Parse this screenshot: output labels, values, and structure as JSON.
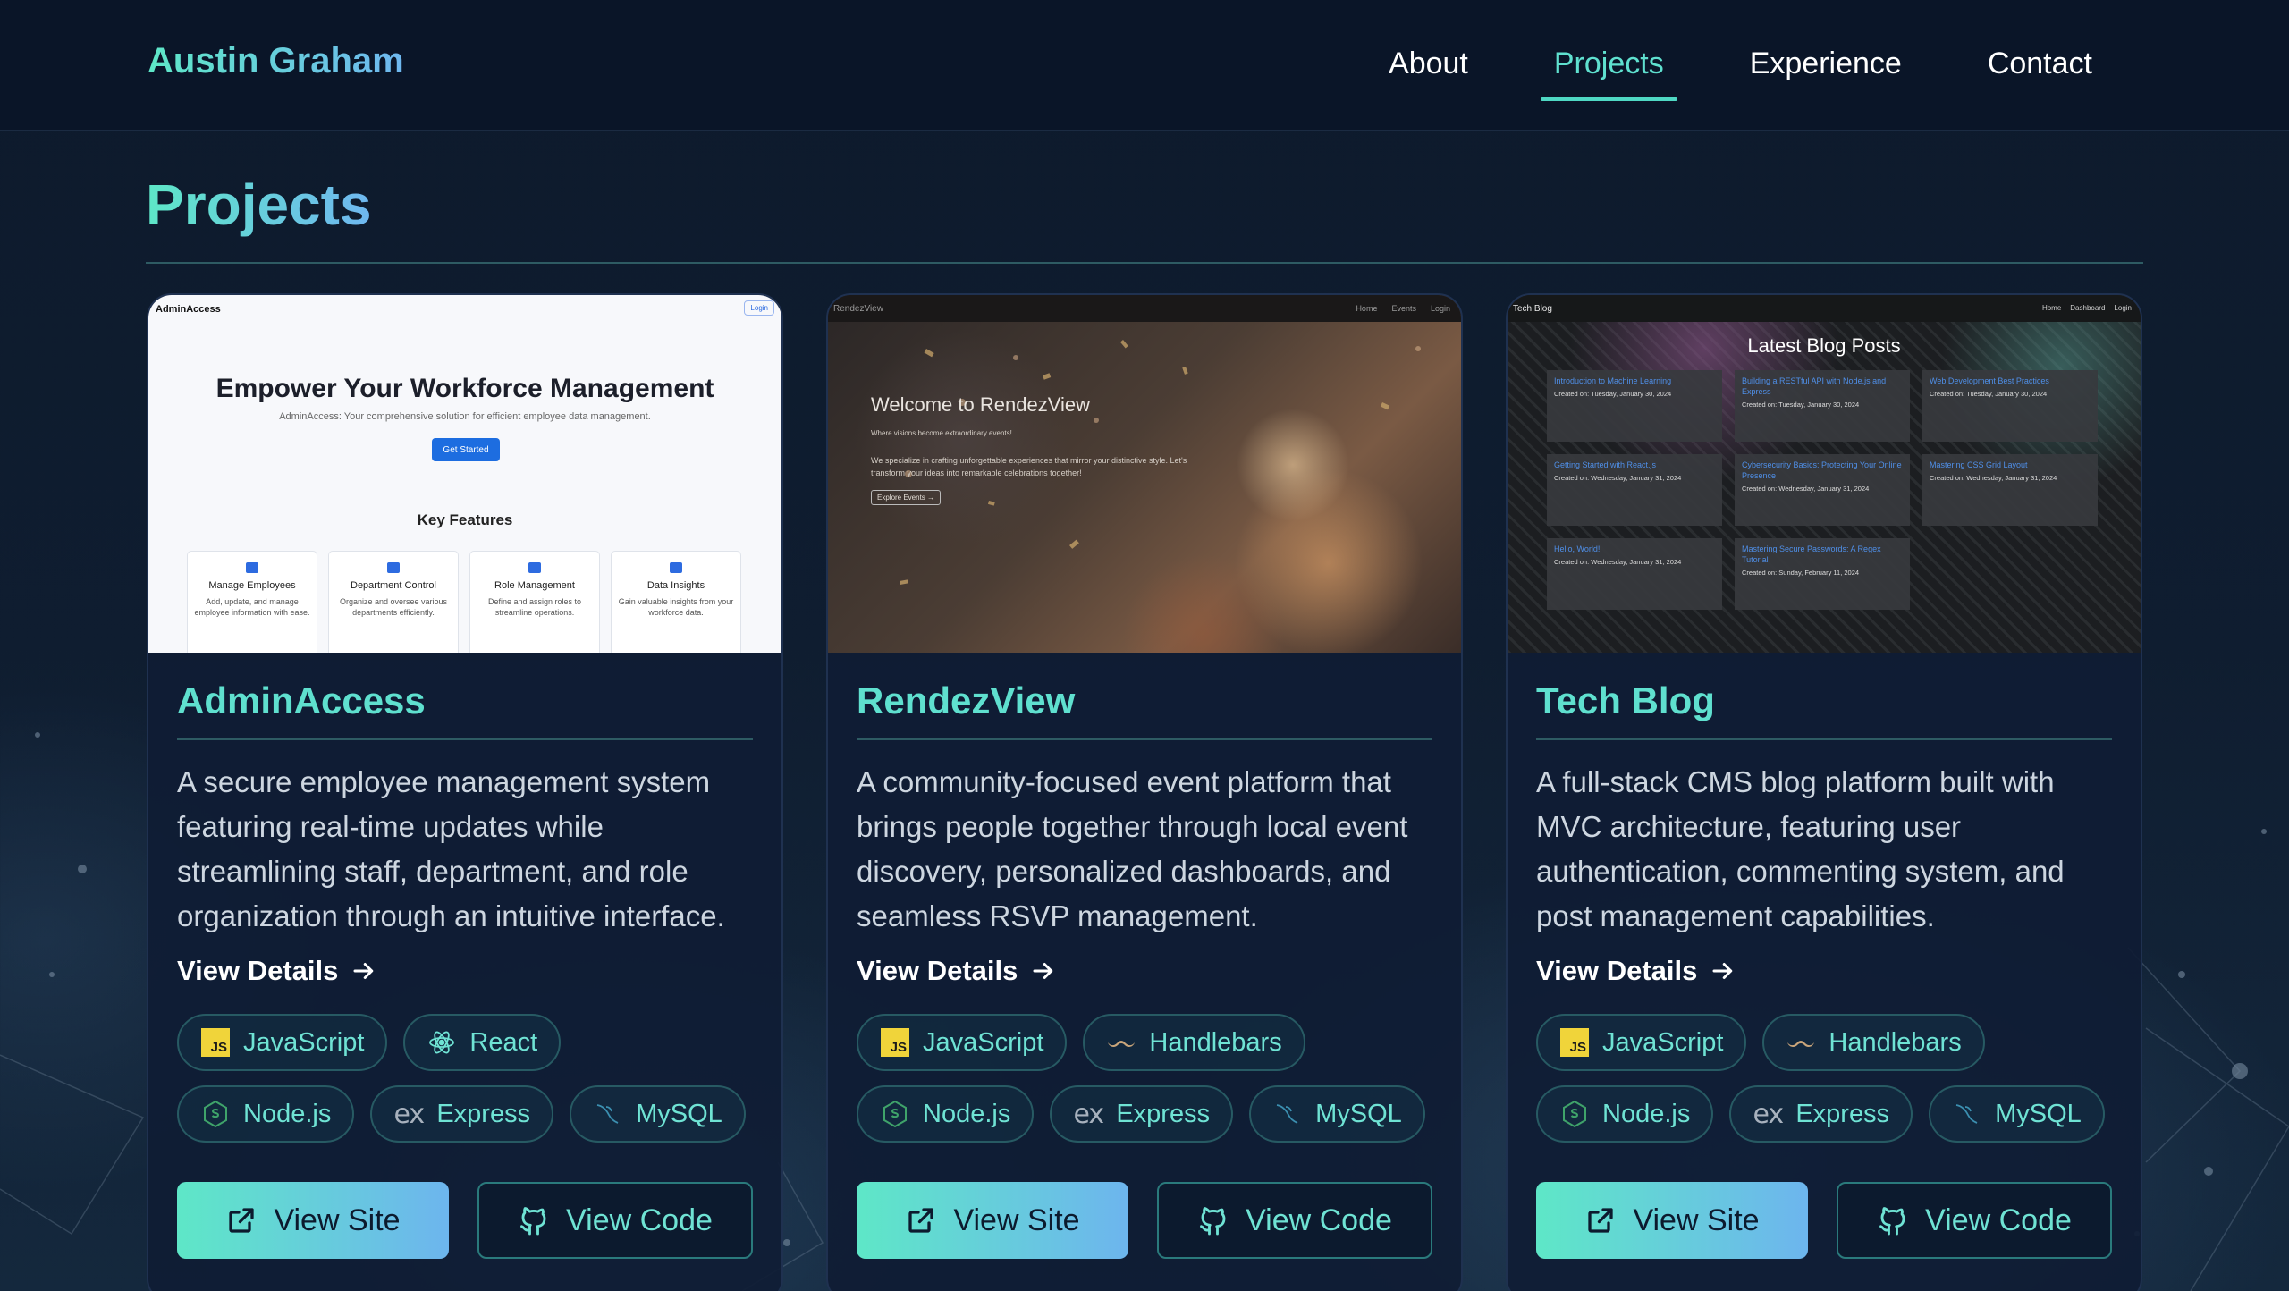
{
  "brand": "Austin Graham",
  "nav": {
    "items": [
      {
        "label": "About",
        "active": false
      },
      {
        "label": "Projects",
        "active": true
      },
      {
        "label": "Experience",
        "active": false
      },
      {
        "label": "Contact",
        "active": false
      }
    ]
  },
  "page": {
    "title": "Projects"
  },
  "colors": {
    "accent": "#5fe0cf",
    "accent_gradient_end": "#6db5ee",
    "background": "#0f1d30",
    "card": "#0f1c34"
  },
  "projects": [
    {
      "title": "AdminAccess",
      "description": "A secure employee management system featuring real-time updates while streamlining staff, department, and role organization through an intuitive interface.",
      "details_label": "View Details",
      "tags": [
        {
          "label": "JavaScript",
          "icon": "javascript-icon"
        },
        {
          "label": "React",
          "icon": "react-icon"
        },
        {
          "label": "Node.js",
          "icon": "nodejs-icon"
        },
        {
          "label": "Express",
          "icon": "express-icon"
        },
        {
          "label": "MySQL",
          "icon": "mysql-icon"
        }
      ],
      "site_label": "View Site",
      "code_label": "View Code",
      "preview": {
        "brand": "AdminAccess",
        "login": "Login",
        "hero": "Empower Your Workforce Management",
        "sub": "AdminAccess: Your comprehensive solution for efficient employee data management.",
        "cta": "Get Started",
        "features_title": "Key Features",
        "features": [
          {
            "title": "Manage Employees",
            "desc": "Add, update, and manage employee information with ease."
          },
          {
            "title": "Department Control",
            "desc": "Organize and oversee various departments efficiently."
          },
          {
            "title": "Role Management",
            "desc": "Define and assign roles to streamline operations."
          },
          {
            "title": "Data Insights",
            "desc": "Gain valuable insights from your workforce data."
          }
        ]
      }
    },
    {
      "title": "RendezView",
      "description": "A community-focused event platform that brings people together through local event discovery, personalized dashboards, and seamless RSVP management.",
      "details_label": "View Details",
      "tags": [
        {
          "label": "JavaScript",
          "icon": "javascript-icon"
        },
        {
          "label": "Handlebars",
          "icon": "handlebars-icon"
        },
        {
          "label": "Node.js",
          "icon": "nodejs-icon"
        },
        {
          "label": "Express",
          "icon": "express-icon"
        },
        {
          "label": "MySQL",
          "icon": "mysql-icon"
        }
      ],
      "site_label": "View Site",
      "code_label": "View Code",
      "preview": {
        "brand": "RendezView",
        "nav": [
          "Home",
          "Events",
          "Login"
        ],
        "hero": "Welcome to RendezView",
        "tagline": "Where visions become extraordinary events!",
        "body": "We specialize in crafting unforgettable experiences that mirror your distinctive style. Let's transform your ideas into remarkable celebrations together!",
        "cta": "Explore Events →"
      }
    },
    {
      "title": "Tech Blog",
      "description": "A full-stack CMS blog platform built with MVC architecture, featuring user authentication, commenting system, and post management capabilities.",
      "details_label": "View Details",
      "tags": [
        {
          "label": "JavaScript",
          "icon": "javascript-icon"
        },
        {
          "label": "Handlebars",
          "icon": "handlebars-icon"
        },
        {
          "label": "Node.js",
          "icon": "nodejs-icon"
        },
        {
          "label": "Express",
          "icon": "express-icon"
        },
        {
          "label": "MySQL",
          "icon": "mysql-icon"
        }
      ],
      "site_label": "View Site",
      "code_label": "View Code",
      "preview": {
        "brand": "Tech Blog",
        "nav": [
          "Home",
          "Dashboard",
          "Login"
        ],
        "heading": "Latest Blog Posts",
        "posts": [
          {
            "title": "Introduction to Machine Learning",
            "date": "Created on: Tuesday, January 30, 2024"
          },
          {
            "title": "Building a RESTful API with Node.js and Express",
            "date": "Created on: Tuesday, January 30, 2024"
          },
          {
            "title": "Web Development Best Practices",
            "date": "Created on: Tuesday, January 30, 2024"
          },
          {
            "title": "Getting Started with React.js",
            "date": "Created on: Wednesday, January 31, 2024"
          },
          {
            "title": "Cybersecurity Basics: Protecting Your Online Presence",
            "date": "Created on: Wednesday, January 31, 2024"
          },
          {
            "title": "Mastering CSS Grid Layout",
            "date": "Created on: Wednesday, January 31, 2024"
          },
          {
            "title": "Hello, World!",
            "date": "Created on: Wednesday, January 31, 2024"
          },
          {
            "title": "Mastering Secure Passwords: A Regex Tutorial",
            "date": "Created on: Sunday, February 11, 2024"
          }
        ]
      }
    }
  ]
}
